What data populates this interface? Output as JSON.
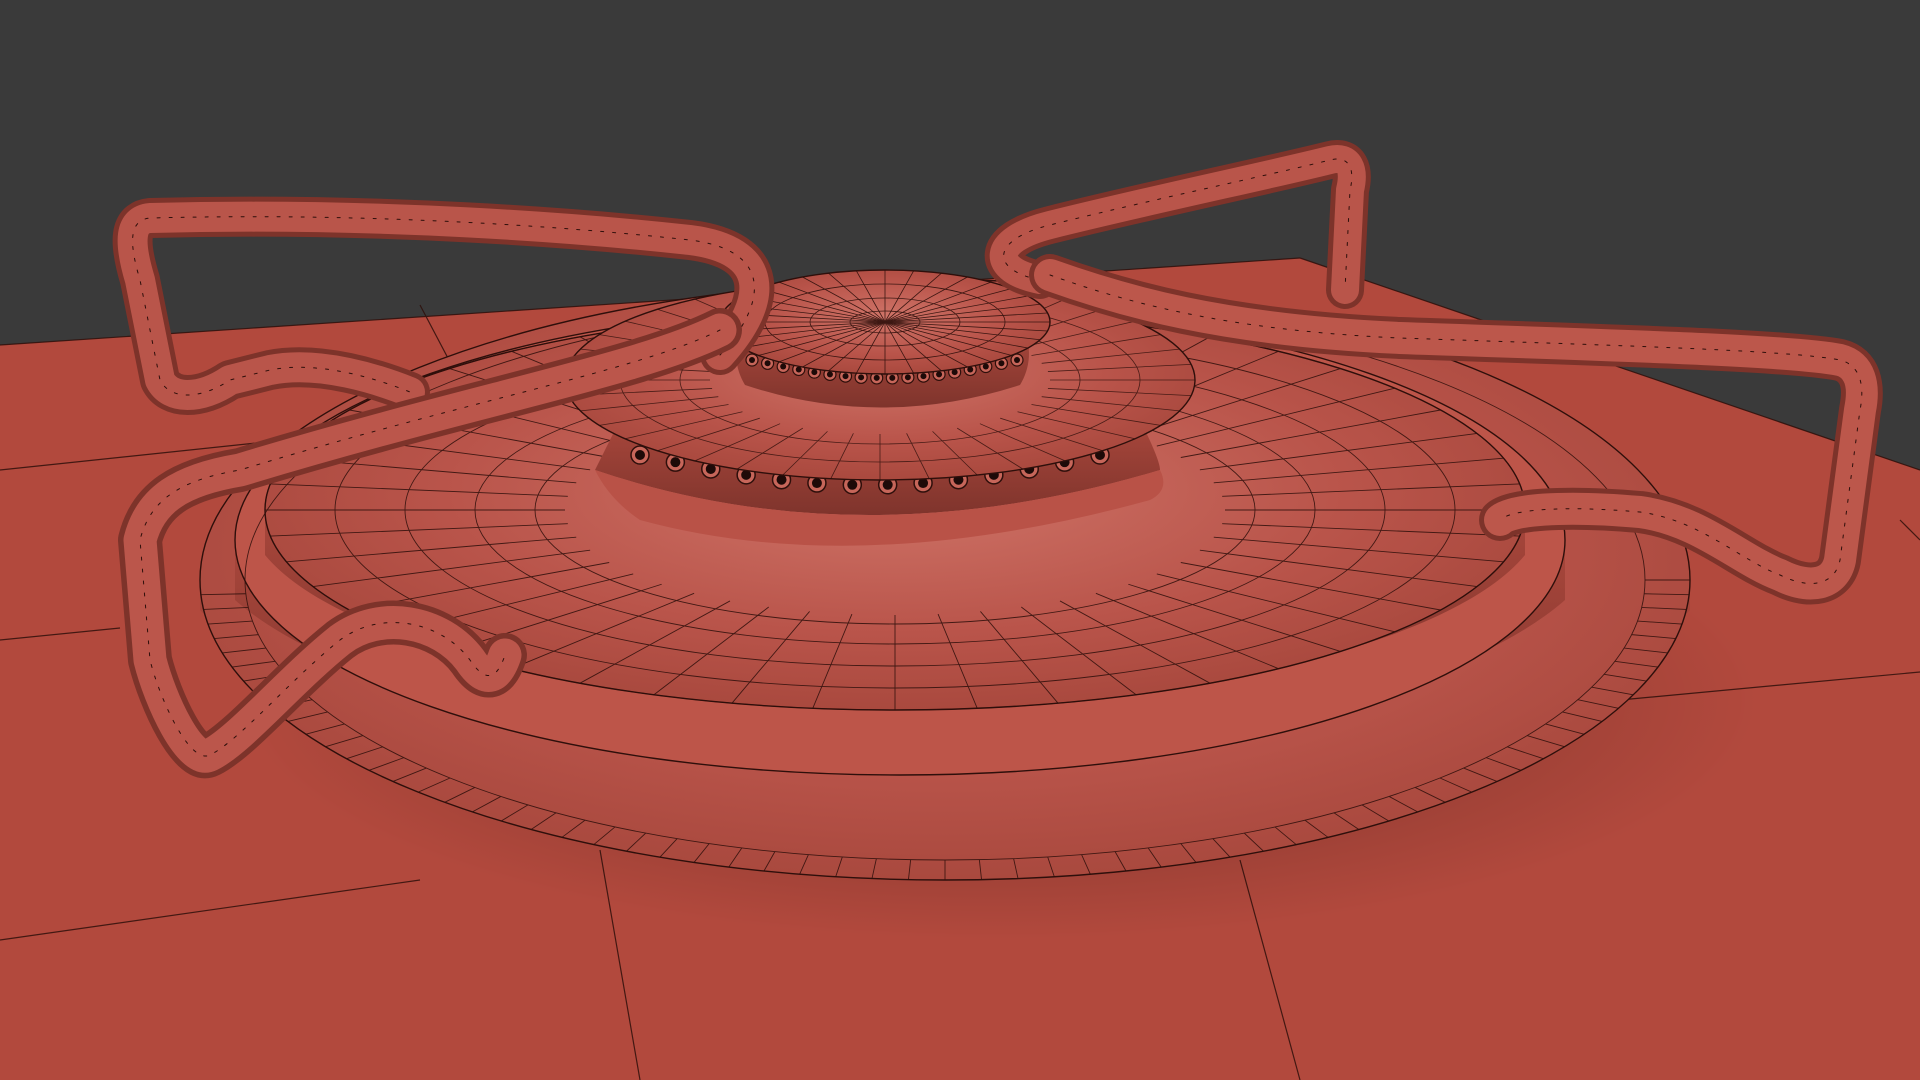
{
  "scene": {
    "subject": "gas-stove-burner-wireframe",
    "colors": {
      "background": "#3a3a3a",
      "surface": "#b2493d",
      "surface_dark": "#8c3a31",
      "surface_light": "#c6594b",
      "highlight": "#cd6e63",
      "wire": "#2e0f0b",
      "hole": "#1e0a08"
    },
    "burner_holes_outer": 14,
    "burner_holes_inner": 18,
    "grate_arms": 4
  }
}
